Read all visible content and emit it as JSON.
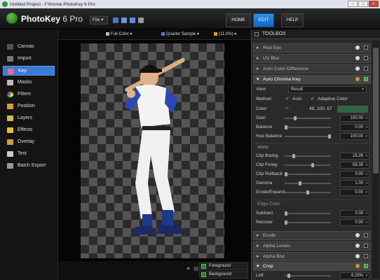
{
  "window": {
    "title": "Untitled Project - FXhome PhotoKey 6 Pro"
  },
  "header": {
    "app_name": "PhotoKey",
    "app_version": "6 Pro",
    "file_menu": "File",
    "nav": [
      "HOME",
      "EDIT",
      "HELP"
    ],
    "active_nav": "EDIT"
  },
  "sidebar": {
    "items": [
      "Canvas",
      "Import",
      "Key",
      "Masks",
      "Filters",
      "Position",
      "Layers",
      "Effects",
      "Overlay",
      "Text",
      "Batch Export"
    ],
    "active": "Key"
  },
  "canvas_options": {
    "color_mode": "Full Color",
    "sample": "Quarter Sample",
    "zoom": "(11.0%)"
  },
  "layers": [
    {
      "label": "Foreground",
      "checked": true
    },
    {
      "label": "Background",
      "checked": true
    }
  ],
  "toolbox": {
    "title": "TOOLBOX",
    "collapsed_top": [
      "Red Eye",
      "UV Blur",
      "Auto Color Difference"
    ],
    "chroma": {
      "title": "Auto Chroma Key",
      "view_label": "View",
      "view_value": "Result",
      "method_label": "Method",
      "method_auto": "Auto",
      "method_adaptive": "Adaptive Color",
      "color_label": "Color",
      "color_value": "48, 100, 67",
      "color_swatch": "#30644a",
      "rows": [
        {
          "label": "Gain",
          "value": "100.00"
        },
        {
          "label": "Balance",
          "value": "0.00"
        },
        {
          "label": "Hue Balance",
          "value": "100.00"
        }
      ],
      "matte_title": "Matte",
      "matte_rows": [
        {
          "label": "Clip Backg.",
          "value": "16.26"
        },
        {
          "label": "Clip Foreg.",
          "value": "59.35"
        },
        {
          "label": "Clip Rollback",
          "value": "0.00"
        },
        {
          "label": "Gamma",
          "value": "1.00"
        },
        {
          "label": "Erode/Expand",
          "value": "0.00"
        }
      ],
      "edge_title": "Edge Color",
      "edge_rows": [
        {
          "label": "Subtract",
          "value": "0.00"
        },
        {
          "label": "Recover",
          "value": "0.00"
        }
      ]
    },
    "collapsed_bottom": [
      "Erode",
      "Alpha Levels",
      "Alpha Blur"
    ],
    "crop": {
      "title": "Crop",
      "row_label": "Left",
      "row_value": "6.25%"
    }
  },
  "colors": {
    "accent": "#2f8fe6",
    "key_green": "#3c9e3c"
  }
}
